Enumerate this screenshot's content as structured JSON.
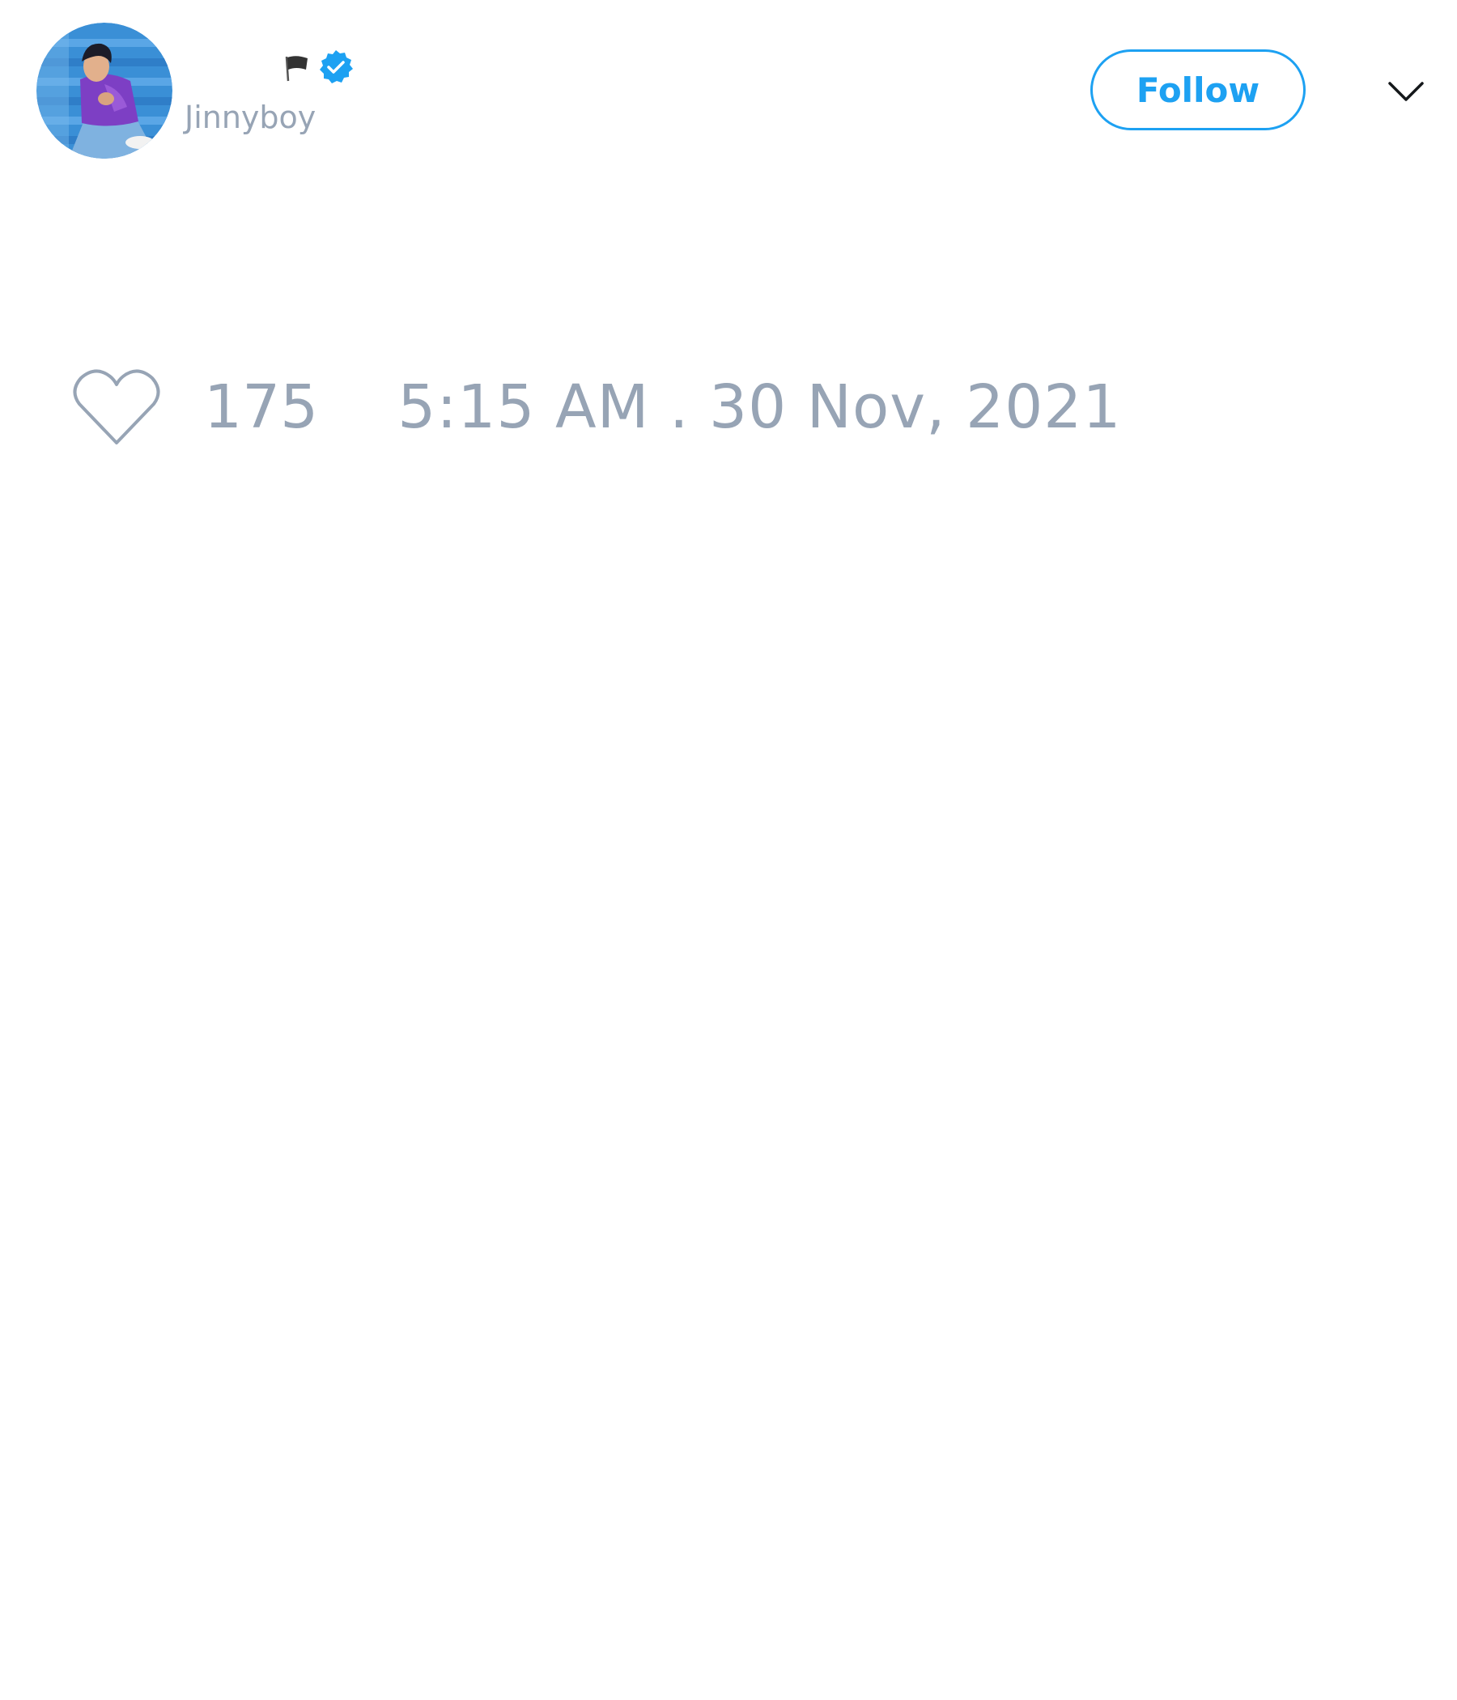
{
  "tweet": {
    "author": {
      "display_name": "",
      "handle": "Jinnyboy",
      "verified": true,
      "avatar_icon": "profile-photo",
      "name_emoji_icon": "black-flag-icon"
    },
    "follow_button": {
      "label": "Follow"
    },
    "menu_icon": "chevron-down-icon",
    "likes": {
      "icon": "heart-icon",
      "count": "175"
    },
    "timestamp": "5:15 AM . 30 Nov, 2021"
  },
  "colors": {
    "accent": "#1da1f2",
    "muted_text": "#97a4b5",
    "background": "#ffffff"
  }
}
